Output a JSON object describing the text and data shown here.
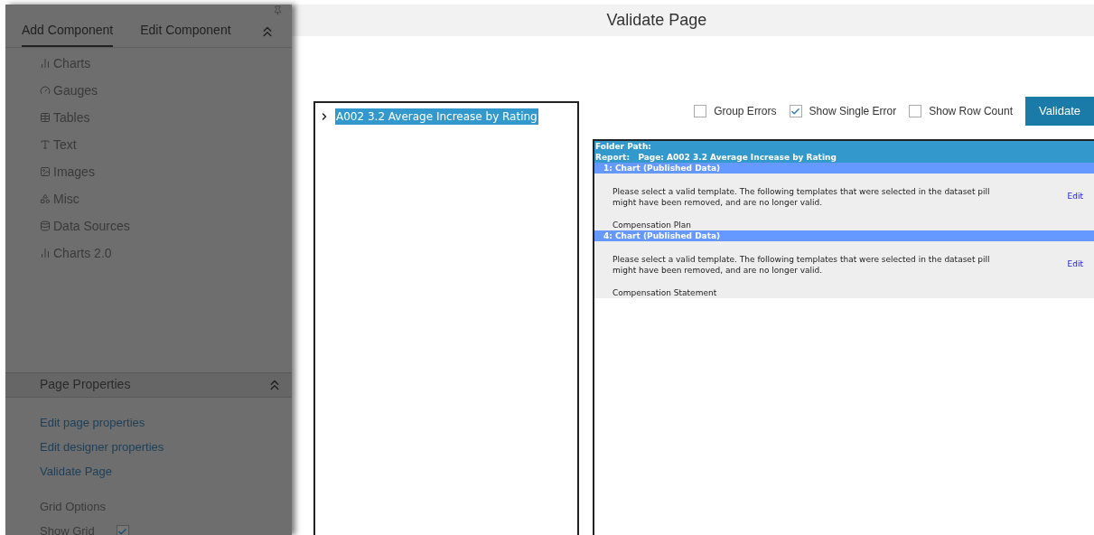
{
  "sidebar": {
    "tabs": [
      {
        "label": "Add Component",
        "selected": true
      },
      {
        "label": "Edit Component",
        "selected": false
      }
    ],
    "components": [
      {
        "kind": "chart",
        "label": "Charts"
      },
      {
        "kind": "gauge",
        "label": "Gauges"
      },
      {
        "kind": "table",
        "label": "Tables"
      },
      {
        "kind": "text",
        "label": "Text"
      },
      {
        "kind": "image",
        "label": "Images"
      },
      {
        "kind": "misc",
        "label": "Misc"
      },
      {
        "kind": "datasource",
        "label": "Data Sources"
      },
      {
        "kind": "chart",
        "label": "Charts 2.0"
      }
    ],
    "page_properties": {
      "title": "Page Properties",
      "links": [
        "Edit page properties",
        "Edit designer properties",
        "Validate Page"
      ],
      "grid_options": "Grid Options",
      "show_grid": {
        "label": "Show Grid",
        "checked": true
      }
    }
  },
  "dialog": {
    "title": "Validate Page",
    "tree": [
      {
        "label": "A002 3.2 Average Increase by Rating",
        "selected": true,
        "expanded": false
      }
    ],
    "options": [
      {
        "label": "Group Errors",
        "checked": false
      },
      {
        "label": "Show Single Error",
        "checked": true
      },
      {
        "label": "Show Row Count",
        "checked": false
      }
    ],
    "validate_button": "Validate",
    "results": {
      "folder_path": "Folder Path:",
      "report": "Report:   Page: A002 3.2 Average Increase by Rating",
      "items": [
        {
          "heading": "1: Chart (Published Data)",
          "message": "Please select a valid template. The following templates that were selected in the dataset pill might have been removed, and are no longer valid.",
          "edit": "Edit",
          "template": "Compensation Plan"
        },
        {
          "heading": "4: Chart (Published Data)",
          "message": "Please select a valid template. The following templates that were selected in the dataset pill might have been removed, and are no longer valid.",
          "edit": "Edit",
          "template": "Compensation Statement"
        }
      ]
    }
  }
}
